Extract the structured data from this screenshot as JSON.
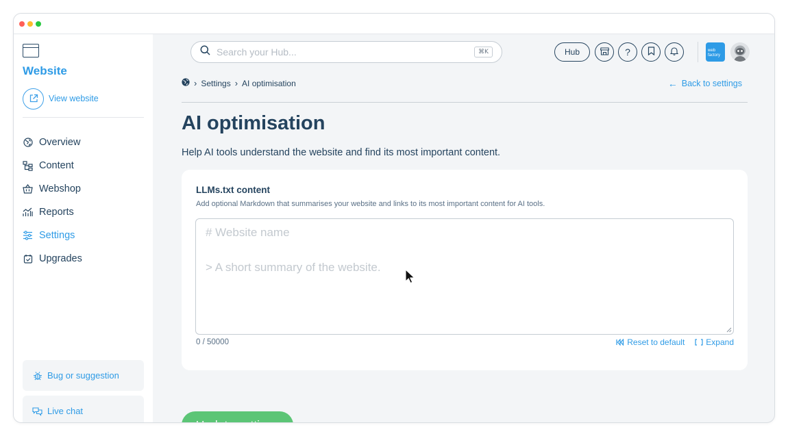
{
  "window": {
    "traffic_lights": [
      "close",
      "minimize",
      "maximize"
    ]
  },
  "sidebar": {
    "site_icon": "browser-window-icon",
    "title": "Website",
    "view_website_label": "View website",
    "nav": [
      {
        "label": "Overview",
        "icon": "globe-icon",
        "active": false
      },
      {
        "label": "Content",
        "icon": "sitemap-icon",
        "active": false
      },
      {
        "label": "Webshop",
        "icon": "basket-icon",
        "active": false
      },
      {
        "label": "Reports",
        "icon": "chart-icon",
        "active": false
      },
      {
        "label": "Settings",
        "icon": "sliders-icon",
        "active": true
      },
      {
        "label": "Upgrades",
        "icon": "calendar-check-icon",
        "active": false
      }
    ],
    "bug_label": "Bug or suggestion",
    "chat_label": "Live chat"
  },
  "topbar": {
    "search_placeholder": "Search your Hub...",
    "search_shortcut": "⌘K",
    "hub_label": "Hub",
    "icon_buttons": [
      "store-icon",
      "help-icon",
      "bookmark-icon",
      "bell-icon"
    ],
    "logo_text_1": "web",
    "logo_text_2": "factory"
  },
  "breadcrumb": {
    "items": [
      "Settings",
      "AI optimisation"
    ],
    "back_label": "Back to settings"
  },
  "page": {
    "title": "AI optimisation",
    "description": "Help AI tools understand the website and find its most important content."
  },
  "llms": {
    "title": "LLMs.txt content",
    "help": "Add optional Markdown that summarises your website and links to its most important content for AI tools.",
    "value": "",
    "placeholder_line1": "# Website name",
    "placeholder_line2": "> A short summary of the website.",
    "counter": "0 / 50000",
    "reset_label": "Reset to default",
    "expand_label": "Expand"
  },
  "update_label": "Update settings",
  "colors": {
    "accent": "#2e9be6",
    "text_dark": "#24435e",
    "success": "#5cc576",
    "background": "#f3f5f7"
  }
}
